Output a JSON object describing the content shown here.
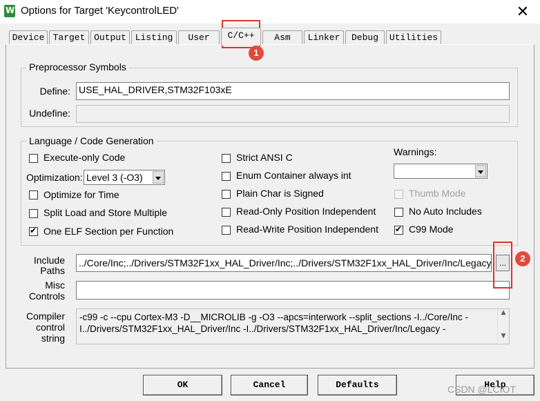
{
  "window": {
    "title": "Options for Target 'KeycontrolLED'",
    "close_label": "✕"
  },
  "tabs": [
    {
      "label": "Device"
    },
    {
      "label": "Target"
    },
    {
      "label": "Output"
    },
    {
      "label": "Listing"
    },
    {
      "label": "User"
    },
    {
      "label": "C/C++"
    },
    {
      "label": "Asm"
    },
    {
      "label": "Linker"
    },
    {
      "label": "Debug"
    },
    {
      "label": "Utilities"
    }
  ],
  "active_tab": "C/C++",
  "preprocessor": {
    "group_title": "Preprocessor Symbols",
    "define_label": "Define:",
    "define_value": "USE_HAL_DRIVER,STM32F103xE",
    "undefine_label": "Undefine:",
    "undefine_value": ""
  },
  "language": {
    "group_title": "Language / Code Generation",
    "execute_only": {
      "label": "Execute-only Code",
      "checked": false
    },
    "optimization_label": "Optimization:",
    "optimization_value": "Level 3 (-O3)",
    "optimize_time": {
      "label": "Optimize for Time",
      "checked": false
    },
    "split_load": {
      "label": "Split Load and Store Multiple",
      "checked": false
    },
    "one_elf": {
      "label": "One ELF Section per Function",
      "checked": true
    },
    "strict_ansi": {
      "label": "Strict ANSI C",
      "checked": false
    },
    "enum_container": {
      "label": "Enum Container always int",
      "checked": false
    },
    "plain_char": {
      "label": "Plain Char is Signed",
      "checked": false
    },
    "ro_position": {
      "label": "Read-Only Position Independent",
      "checked": false
    },
    "rw_position": {
      "label": "Read-Write Position Independent",
      "checked": false
    },
    "warnings_label": "Warnings:",
    "warnings_value": "",
    "thumb_mode": {
      "label": "Thumb Mode",
      "checked": false,
      "disabled": true
    },
    "no_auto_includes": {
      "label": "No Auto Includes",
      "checked": false
    },
    "c99_mode": {
      "label": "C99 Mode",
      "checked": true
    }
  },
  "include": {
    "label_line1": "Include",
    "label_line2": "Paths",
    "value": "../Core/Inc;../Drivers/STM32F1xx_HAL_Driver/Inc;../Drivers/STM32F1xx_HAL_Driver/Inc/Legacy;",
    "browse_label": "..."
  },
  "misc": {
    "label_line1": "Misc",
    "label_line2": "Controls",
    "value": ""
  },
  "compiler": {
    "label_line1": "Compiler",
    "label_line2": "control",
    "label_line3": "string",
    "line1": "-c99 -c --cpu Cortex-M3 -D__MICROLIB -g -O3 --apcs=interwork --split_sections -I../Core/Inc -",
    "line2": "I../Drivers/STM32F1xx_HAL_Driver/Inc -I../Drivers/STM32F1xx_HAL_Driver/Inc/Legacy -"
  },
  "buttons": {
    "ok": "OK",
    "cancel": "Cancel",
    "defaults": "Defaults",
    "help": "Help"
  },
  "annotations": {
    "badge1": "1",
    "badge2": "2",
    "color": "#e03030"
  },
  "watermark": "CSDN @LCIOT"
}
